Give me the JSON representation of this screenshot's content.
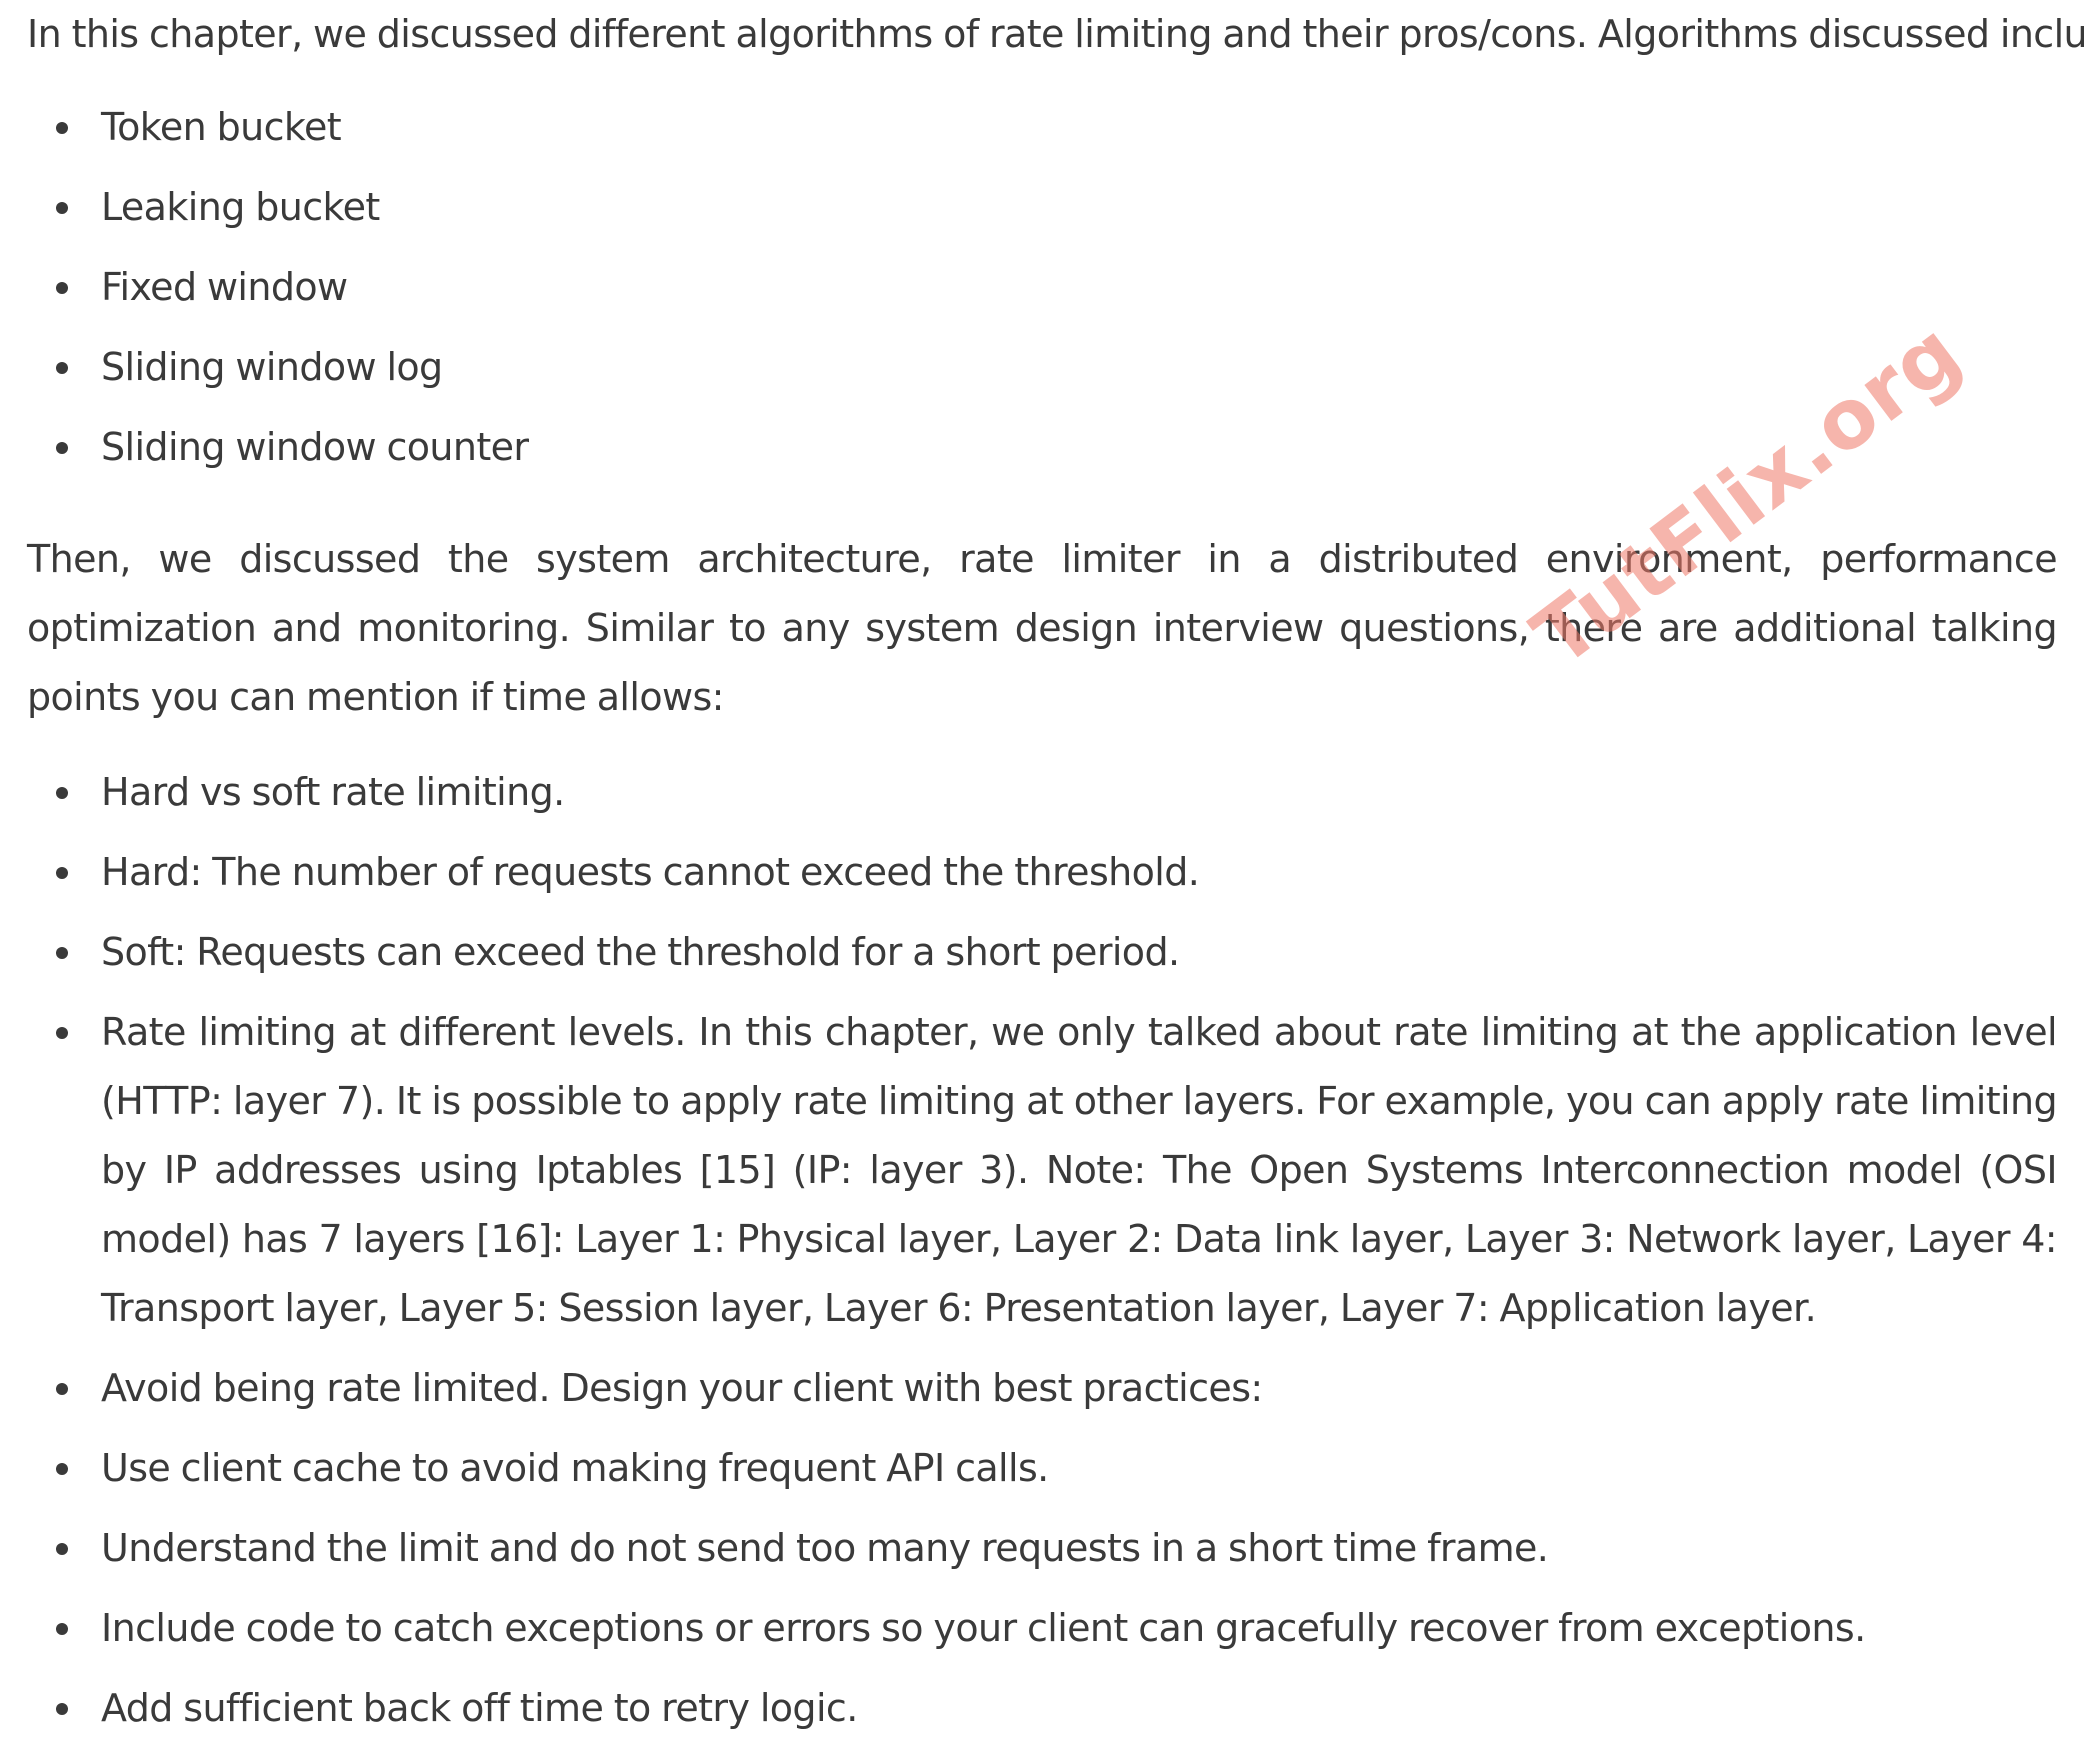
{
  "intro": "In this chapter, we discussed different algorithms of rate limiting and their pros/cons. Algorithms discussed include:",
  "algorithms": [
    "Token bucket",
    "Leaking bucket",
    "Fixed window",
    "Sliding window log",
    "Sliding window counter"
  ],
  "paragraph2": "Then, we discussed the system architecture, rate limiter in a distributed environment, performance optimization and monitoring. Similar to any system design interview questions, there are additional talking points you can mention if time allows:",
  "talking_points": [
    "Hard vs soft rate limiting.",
    "Hard: The number of requests cannot exceed the threshold.",
    "Soft: Requests can exceed the threshold for a short period.",
    "Rate limiting at different levels. In this chapter, we only talked about rate limiting at the application level (HTTP: layer 7). It is possible to apply rate limiting at other layers. For example, you can apply rate limiting by IP addresses using Iptables [15] (IP: layer 3). Note: The Open Systems Interconnection model (OSI model) has 7 layers [16]: Layer 1: Physical layer, Layer 2: Data link layer, Layer 3: Network layer, Layer 4: Transport layer, Layer 5: Session layer, Layer 6: Presentation layer, Layer 7: Application layer.",
    "Avoid being rate limited. Design your client with best practices:",
    "Use client cache to avoid making frequent API calls.",
    "Understand the limit and do not send too many requests in a short time frame.",
    "Include code to catch exceptions or errors so your client can gracefully recover from exceptions.",
    "Add sufficient back off time to retry logic."
  ],
  "watermark": "TutFlix.org",
  "colors": {
    "text": "#3a3a3a",
    "watermark": "#ee7868",
    "background": "#ffffff"
  }
}
